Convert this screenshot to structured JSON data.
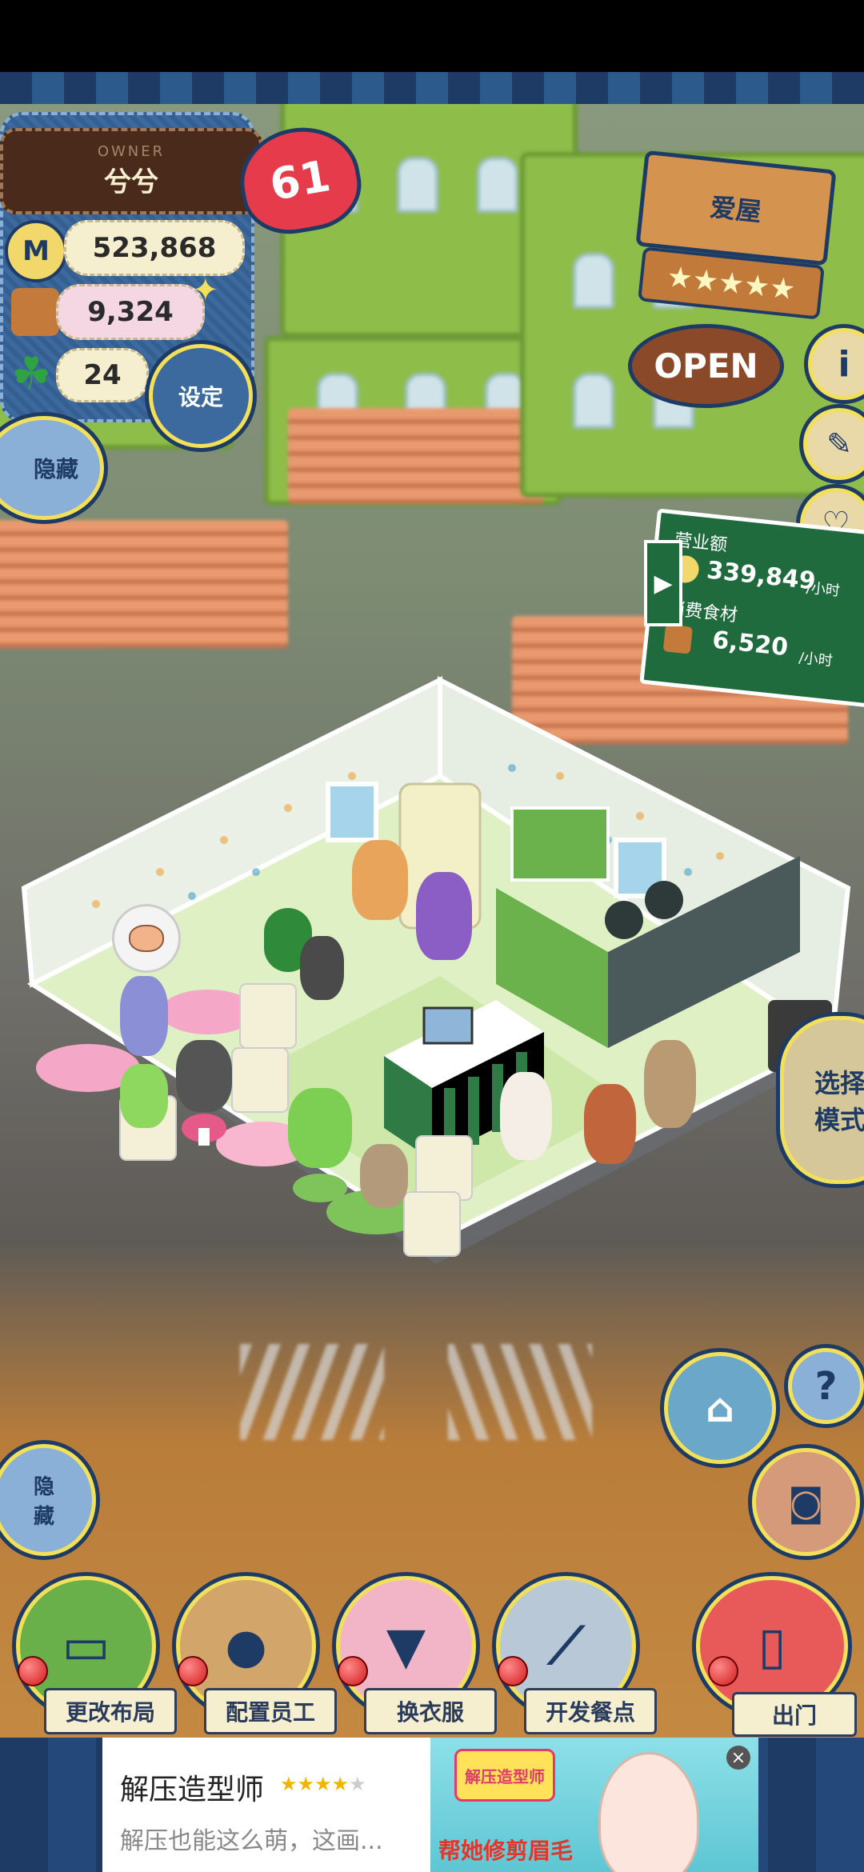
{
  "owner": {
    "caption": "OWNER",
    "name": "兮兮",
    "level": "61"
  },
  "currency": {
    "coins": "523,868",
    "ingredients": "9,324",
    "clover": "24"
  },
  "buttons": {
    "settings": "设定",
    "hide_top": "隐藏",
    "hide_bottom": "隐\n藏",
    "open_sign": "OPEN",
    "select_mode": "选择\n模式"
  },
  "shop": {
    "name": "爱屋",
    "stars": 5
  },
  "stats": {
    "revenue_label": "营业额",
    "revenue_value": "339,849",
    "revenue_unit": "/小时",
    "food_label": "消费食材",
    "food_value": "6,520",
    "food_unit": "/小时"
  },
  "bottom_menu": [
    {
      "label": "更改布局",
      "icon": "table-icon"
    },
    {
      "label": "配置员工",
      "icon": "bear-head-icon"
    },
    {
      "label": "换衣服",
      "icon": "shirt-icon"
    },
    {
      "label": "开发餐点",
      "icon": "knife-icon"
    },
    {
      "label": "出门",
      "icon": "door-icon"
    }
  ],
  "ad": {
    "title": "解压造型师",
    "subtitle": "解压也能这么萌，这画...",
    "banner_text": "帮她修剪眉毛",
    "logo_text": "解压造型师",
    "rating": 4
  }
}
